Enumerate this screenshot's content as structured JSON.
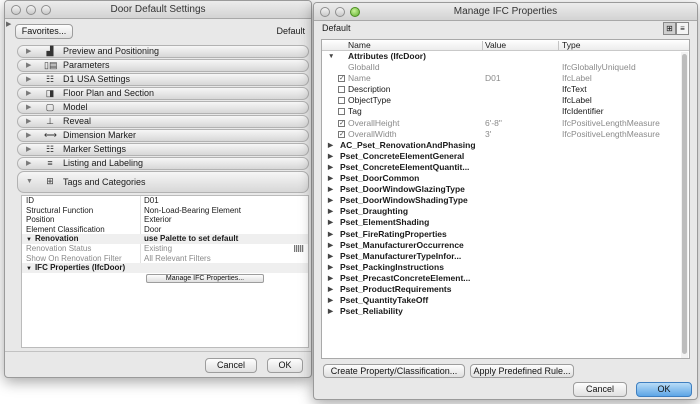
{
  "left_window": {
    "title": "Door Default Settings",
    "favorites_label": "Favorites...",
    "default_label": "Default",
    "sections": [
      {
        "label": "Preview and Positioning",
        "icon": "preview-icon"
      },
      {
        "label": "Parameters",
        "icon": "parameters-icon"
      },
      {
        "label": "D1 USA Settings",
        "icon": "settings-list-icon"
      },
      {
        "label": "Floor Plan and Section",
        "icon": "floor-plan-icon"
      },
      {
        "label": "Model",
        "icon": "model-icon"
      },
      {
        "label": "Reveal",
        "icon": "reveal-icon"
      },
      {
        "label": "Dimension Marker",
        "icon": "dimension-marker-icon"
      },
      {
        "label": "Marker Settings",
        "icon": "marker-settings-icon"
      },
      {
        "label": "Listing and Labeling",
        "icon": "listing-icon"
      },
      {
        "label": "Tags and Categories",
        "icon": "tags-icon"
      }
    ],
    "properties": [
      {
        "name": "ID",
        "value": "D01"
      },
      {
        "name": "Structural Function",
        "value": "Non-Load-Bearing Element"
      },
      {
        "name": "Position",
        "value": "Exterior"
      },
      {
        "name": "Element Classification",
        "value": "Door"
      },
      {
        "name": "Renovation",
        "value": "use Palette to set default"
      },
      {
        "name": "Renovation Status",
        "value": "Existing"
      },
      {
        "name": "Show On Renovation Filter",
        "value": "All Relevant Filters"
      },
      {
        "name": "IFC Properties (IfcDoor)",
        "value": ""
      }
    ],
    "manage_ifc_label": "Manage IFC Properties...",
    "cancel_label": "Cancel",
    "ok_label": "OK"
  },
  "right_window": {
    "title": "Manage IFC Properties",
    "default_label": "Default",
    "columns": {
      "name": "Name",
      "value": "Value",
      "type": "Type"
    },
    "attributes_group": "Attributes (IfcDoor)",
    "attributes": [
      {
        "name": "GlobalId",
        "value": "",
        "type": "IfcGloballyUniqueId",
        "checked": null
      },
      {
        "name": "Name",
        "value": "D01",
        "type": "IfcLabel",
        "checked": true
      },
      {
        "name": "Description",
        "value": "",
        "type": "IfcText",
        "checked": false
      },
      {
        "name": "ObjectType",
        "value": "",
        "type": "IfcLabel",
        "checked": false
      },
      {
        "name": "Tag",
        "value": "",
        "type": "IfcIdentifier",
        "checked": false
      },
      {
        "name": "OverallHeight",
        "value": "6'-8\"",
        "type": "IfcPositiveLengthMeasure",
        "checked": true
      },
      {
        "name": "OverallWidth",
        "value": "3'",
        "type": "IfcPositiveLengthMeasure",
        "checked": true
      }
    ],
    "psets": [
      "AC_Pset_RenovationAndPhasing",
      "Pset_ConcreteElementGeneral",
      "Pset_ConcreteElementQuantit...",
      "Pset_DoorCommon",
      "Pset_DoorWindowGlazingType",
      "Pset_DoorWindowShadingType",
      "Pset_Draughting",
      "Pset_ElementShading",
      "Pset_FireRatingProperties",
      "Pset_ManufacturerOccurrence",
      "Pset_ManufacturerTypeInfor...",
      "Pset_PackingInstructions",
      "Pset_PrecastConcreteElement...",
      "Pset_ProductRequirements",
      "Pset_QuantityTakeOff",
      "Pset_Reliability"
    ],
    "create_property_label": "Create Property/Classification...",
    "apply_predefined_label": "Apply Predefined Rule...",
    "cancel_label": "Cancel",
    "ok_label": "OK",
    "colors": {
      "ok_accent": "#5da6e6"
    }
  }
}
